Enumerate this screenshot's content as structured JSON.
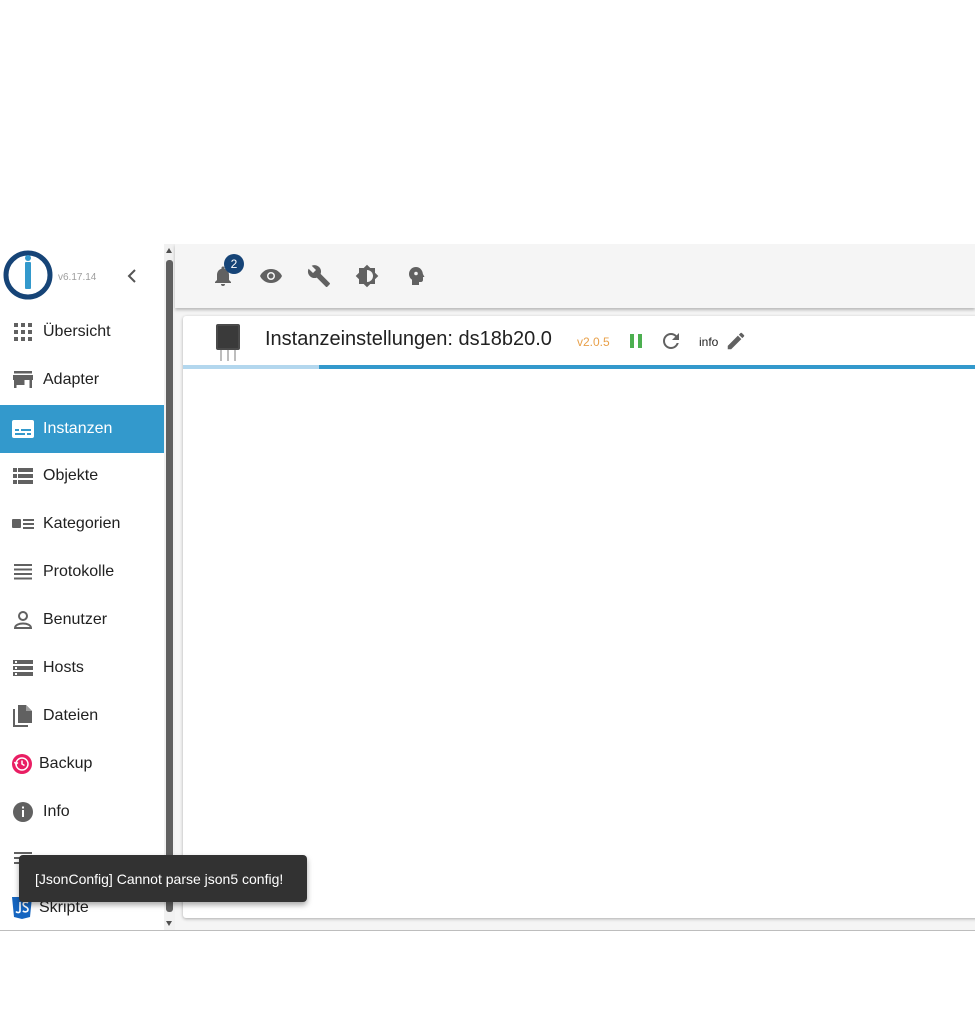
{
  "app": {
    "version": "v6.17.14"
  },
  "sidebar": {
    "items": [
      {
        "label": "Übersicht",
        "icon": "apps-grid-icon"
      },
      {
        "label": "Adapter",
        "icon": "store-icon"
      },
      {
        "label": "Instanzen",
        "icon": "instances-icon",
        "active": true
      },
      {
        "label": "Objekte",
        "icon": "list-icon"
      },
      {
        "label": "Kategorien",
        "icon": "categories-icon"
      },
      {
        "label": "Protokolle",
        "icon": "log-lines-icon"
      },
      {
        "label": "Benutzer",
        "icon": "person-icon"
      },
      {
        "label": "Hosts",
        "icon": "hosts-icon"
      },
      {
        "label": "Dateien",
        "icon": "file-icon"
      },
      {
        "label": "Backup",
        "icon": "backup-icon"
      },
      {
        "label": "Info",
        "icon": "info-icon"
      },
      {
        "label": "Skripte",
        "icon": "javascript-icon"
      }
    ]
  },
  "toolbar": {
    "notification_count": "2"
  },
  "instance": {
    "title": "Instanzeinstellungen: ds18b20.0",
    "version": "v2.0.5",
    "info_label": "info"
  },
  "progress": {
    "value_fraction": 0.83
  },
  "snackbar": {
    "message": "[JsonConfig] Cannot parse json5 config!"
  },
  "colors": {
    "accent": "#3399cc",
    "badge": "#164477",
    "version_tag": "#e8a04a",
    "running_green": "#4caf50",
    "backup_red": "#e91e63"
  }
}
